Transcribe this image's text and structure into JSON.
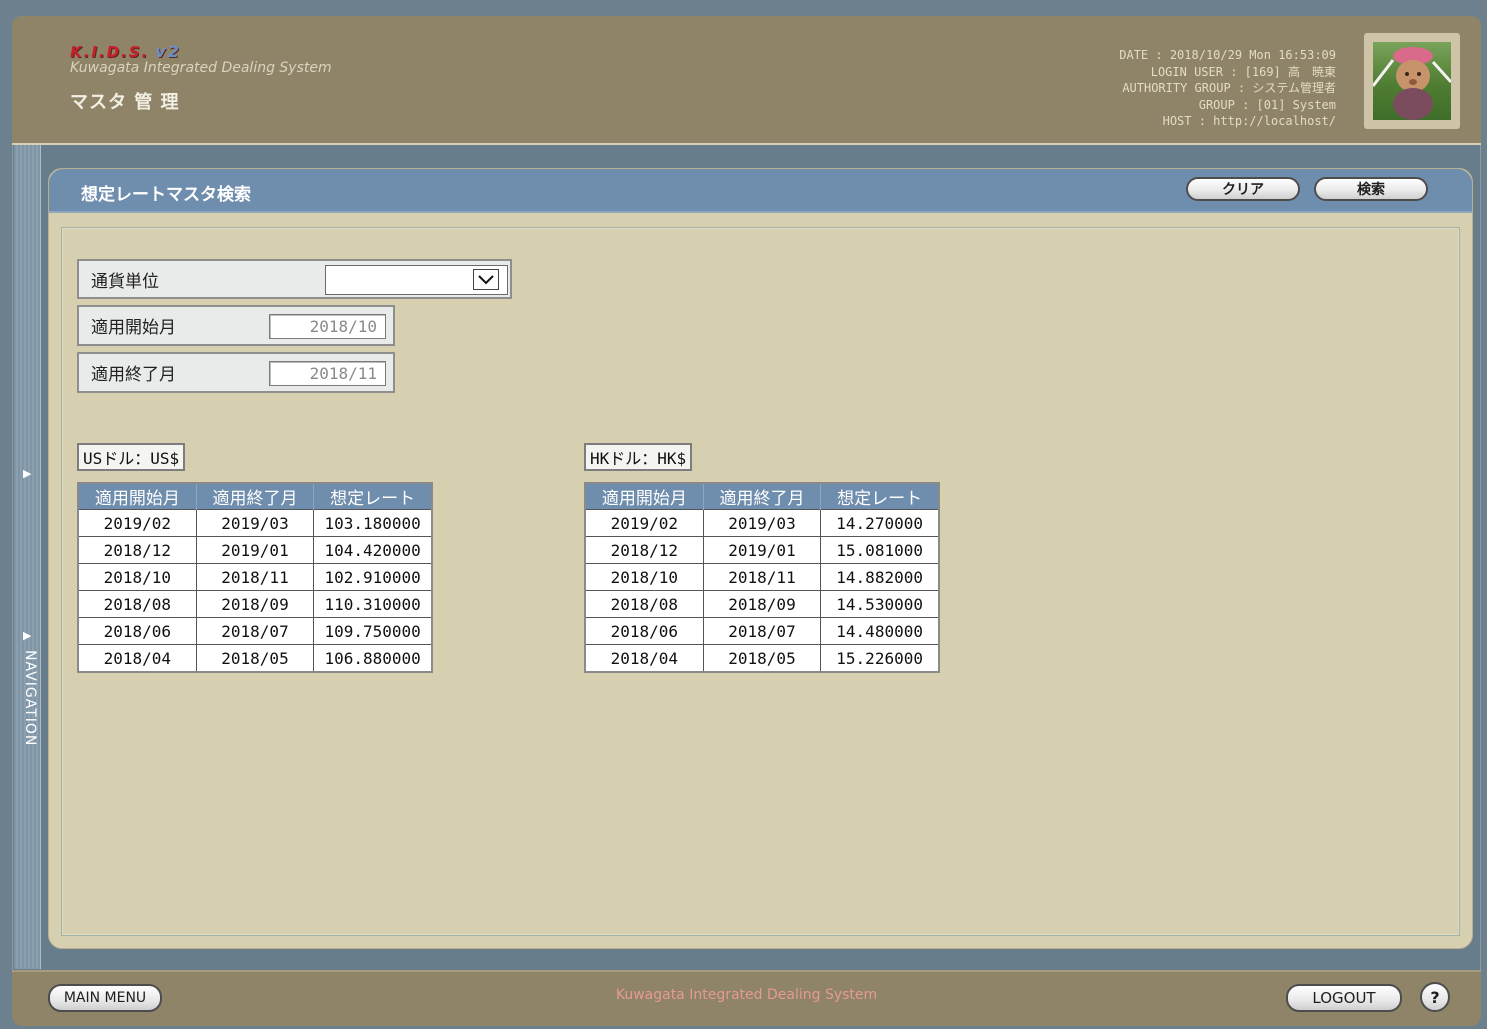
{
  "header": {
    "logo_text": "K.I.D.S.",
    "logo_version": "v2",
    "system_name": "Kuwagata Integrated Dealing System",
    "page_section": "マスタ 管 理",
    "info_lines": [
      "DATE : 2018/10/29 Mon 16:53:09",
      "LOGIN USER : [169] 高　暁東",
      "AUTHORITY GROUP : システム管理者",
      "GROUP : [01] System",
      "HOST : http://localhost/"
    ]
  },
  "nav": {
    "label": "NAVIGATION"
  },
  "panel": {
    "title": "想定レートマスタ検索",
    "clear_label": "クリア",
    "search_label": "検索"
  },
  "form": {
    "currency_label": "通貨単位",
    "currency_value": "",
    "start_label": "適用開始月",
    "start_value": "2018/10",
    "end_label": "適用終了月",
    "end_value": "2018/11"
  },
  "tables": [
    {
      "currency": "USドル：US$",
      "headers": [
        "適用開始月",
        "適用終了月",
        "想定レート"
      ],
      "rows": [
        [
          "2019/02",
          "2019/03",
          "103.180000"
        ],
        [
          "2018/12",
          "2019/01",
          "104.420000"
        ],
        [
          "2018/10",
          "2018/11",
          "102.910000"
        ],
        [
          "2018/08",
          "2018/09",
          "110.310000"
        ],
        [
          "2018/06",
          "2018/07",
          "109.750000"
        ],
        [
          "2018/04",
          "2018/05",
          "106.880000"
        ]
      ]
    },
    {
      "currency": "HKドル：HK$",
      "headers": [
        "適用開始月",
        "適用終了月",
        "想定レート"
      ],
      "rows": [
        [
          "2019/02",
          "2019/03",
          "14.270000"
        ],
        [
          "2018/12",
          "2019/01",
          "15.081000"
        ],
        [
          "2018/10",
          "2018/11",
          "14.882000"
        ],
        [
          "2018/08",
          "2018/09",
          "14.530000"
        ],
        [
          "2018/06",
          "2018/07",
          "14.480000"
        ],
        [
          "2018/04",
          "2018/05",
          "15.226000"
        ]
      ]
    }
  ],
  "footer": {
    "main_menu_label": "MAIN MENU",
    "system_name": "Kuwagata Integrated Dealing System",
    "logout_label": "LOGOUT",
    "help_label": "?"
  }
}
